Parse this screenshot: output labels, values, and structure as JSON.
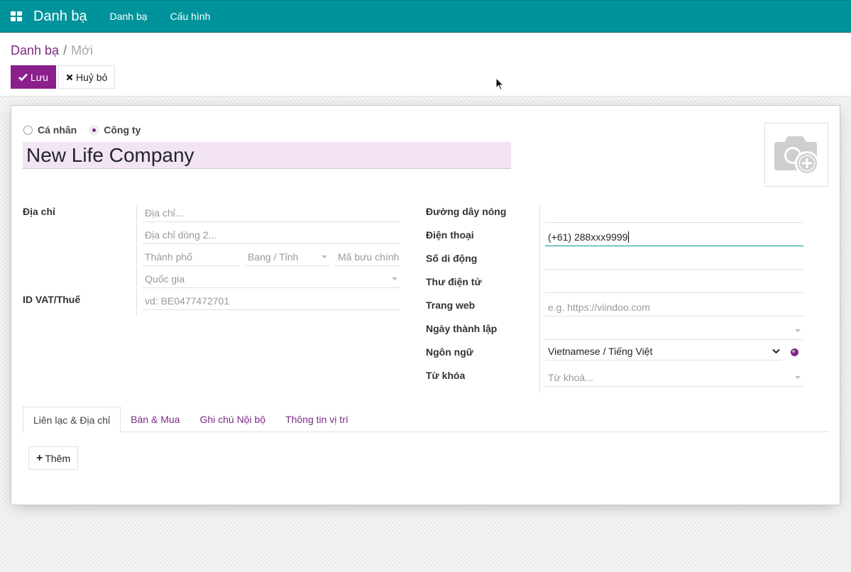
{
  "navbar": {
    "app_title": "Danh bạ",
    "menu": [
      "Danh bạ",
      "Cấu hình"
    ],
    "color": "#00939b"
  },
  "breadcrumb": {
    "parent": "Danh bạ",
    "separator": "/",
    "current": "Mới"
  },
  "toolbar": {
    "save_label": "Lưu",
    "discard_label": "Huỷ bỏ",
    "primary_color": "#8b1f8c"
  },
  "form": {
    "company_type": {
      "options": [
        "Cá nhân",
        "Công ty"
      ],
      "selected": "Công ty"
    },
    "name": "New Life Company",
    "address": {
      "label": "Địa chỉ",
      "street_placeholder": "Địa chỉ...",
      "street2_placeholder": "Địa chỉ dòng 2...",
      "city_placeholder": "Thành phố",
      "state_placeholder": "Bang / Tỉnh",
      "zip_placeholder": "Mã bưu chính",
      "country_placeholder": "Quốc gia"
    },
    "vat": {
      "label": "ID VAT/Thuế",
      "placeholder": "vd: BE0477472701"
    },
    "right_fields": {
      "hotline_label": "Đường dây nóng",
      "hotline_value": "",
      "phone_label": "Điện thoại",
      "phone_value": "(+61) 288xxx9999",
      "mobile_label": "Số di động",
      "mobile_value": "",
      "email_label": "Thư điện tử",
      "email_value": "",
      "website_label": "Trang web",
      "website_placeholder": "e.g. https://viindoo.com",
      "founded_label": "Ngày thành lập",
      "founded_value": "",
      "language_label": "Ngôn ngữ",
      "language_value": "Vietnamese / Tiếng Việt",
      "tags_label": "Từ khóa",
      "tags_placeholder": "Từ khoá..."
    }
  },
  "tabs": [
    {
      "label": "Liên lạc & Địa chỉ",
      "active": true
    },
    {
      "label": "Bán & Mua",
      "active": false
    },
    {
      "label": "Ghi chú Nội bộ",
      "active": false
    },
    {
      "label": "Thông tin vị trí",
      "active": false
    }
  ],
  "contacts_tab": {
    "add_label": "Thêm"
  }
}
